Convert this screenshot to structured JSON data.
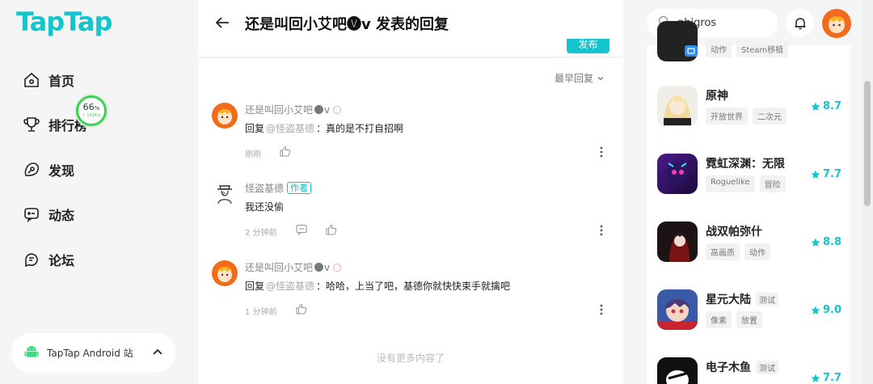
{
  "brand": {
    "logo": "TapTap",
    "accent": "#15c5ce"
  },
  "nav": [
    {
      "label": "首页",
      "icon": "home-icon"
    },
    {
      "label": "排行榜",
      "icon": "trophy-icon"
    },
    {
      "label": "发现",
      "icon": "discover-icon"
    },
    {
      "label": "动态",
      "icon": "feed-icon"
    },
    {
      "label": "论坛",
      "icon": "forum-icon"
    }
  ],
  "speed": {
    "percent": "66",
    "unit": "%",
    "rate": "↑ 152K/s"
  },
  "android": {
    "label": "TapTap Android 站"
  },
  "header": {
    "title": "还是叫回小艾吧🅥v 发表的回复",
    "publish": "发布"
  },
  "sort": {
    "label": "最早回复"
  },
  "comments": [
    {
      "name": "还是叫回小艾吧",
      "suffix": "v",
      "author": false,
      "reply_prefix": "回复",
      "mention": "@怪盗基德",
      "text": "：真的是不打自招啊",
      "time": "刚刚"
    },
    {
      "name": "怪盗基德",
      "author_tag": "作者",
      "author": true,
      "text": "我还没偷",
      "time": "2 分钟前"
    },
    {
      "name": "还是叫回小艾吧",
      "suffix": "v",
      "author": false,
      "reply_prefix": "回复",
      "mention": "@怪盗基德",
      "text": "：哈哈，上当了吧，基德你就快快束手就擒吧",
      "time": "1 分钟前"
    }
  ],
  "no_more": "没有更多内容了",
  "search": {
    "value": "phigros"
  },
  "games": [
    {
      "name": "",
      "tags": [
        "动作",
        "Steam移植"
      ],
      "score": ""
    },
    {
      "name": "原神",
      "tags": [
        "开放世界",
        "二次元"
      ],
      "score": "8.7"
    },
    {
      "name": "霓虹深渊：无限",
      "tags": [
        "Roguelike",
        "冒险"
      ],
      "score": "7.7"
    },
    {
      "name": "战双帕弥什",
      "tags": [
        "高画质",
        "动作"
      ],
      "score": "8.8"
    },
    {
      "name": "星元大陆",
      "test": "测试",
      "tags": [
        "像素",
        "放置"
      ],
      "score": "9.0"
    },
    {
      "name": "电子木鱼",
      "test": "测试",
      "tags": [],
      "score": "7.7"
    }
  ]
}
